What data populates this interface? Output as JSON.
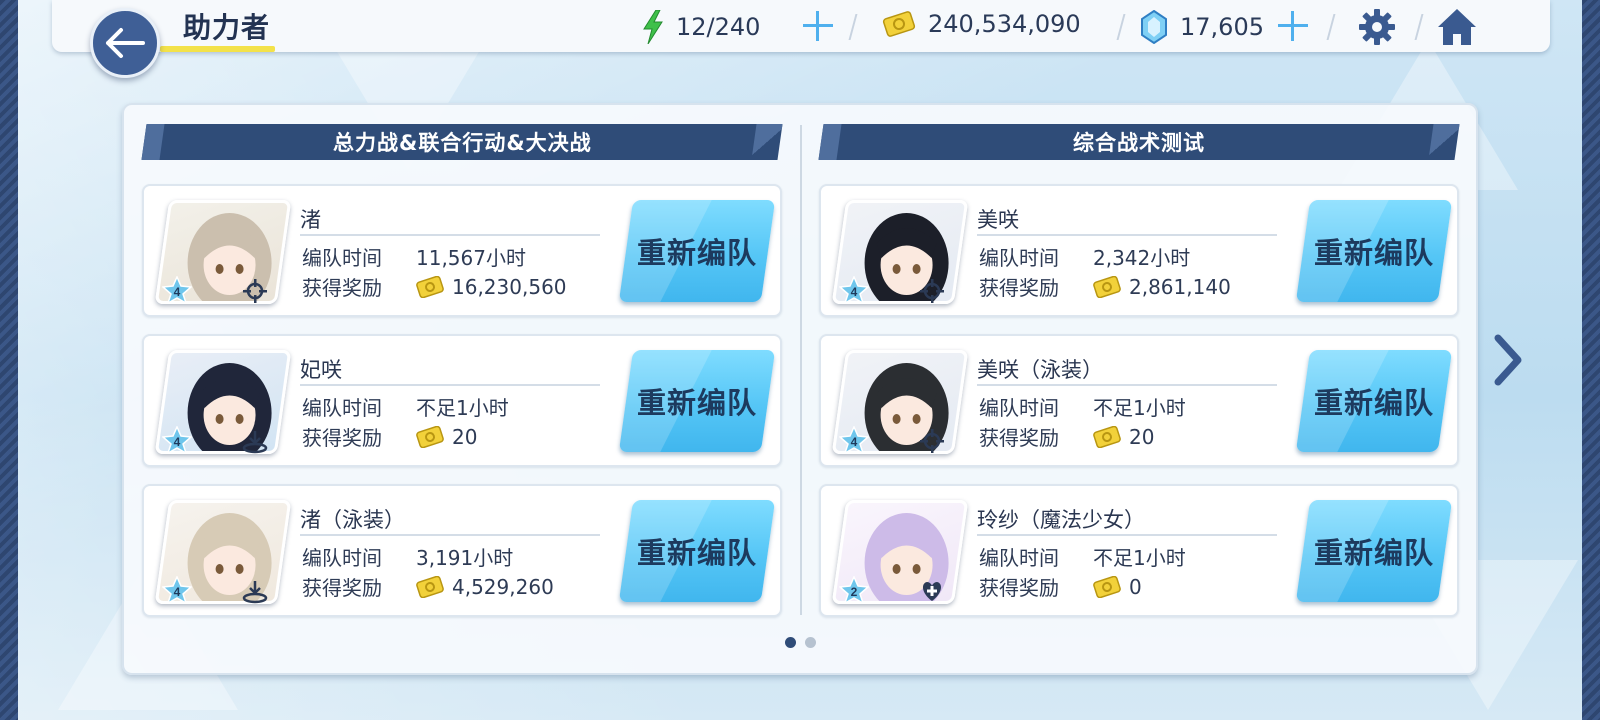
{
  "header": {
    "title": "助力者",
    "energy": "12/240",
    "credits": "240,534,090",
    "gems": "17,605"
  },
  "sections": [
    {
      "title": "总力战&联合行动&大决战"
    },
    {
      "title": "综合战术测试"
    }
  ],
  "labels": {
    "time_label": "编队时间",
    "reward_label": "获得奖励",
    "reform_button": "重新编队"
  },
  "left_cards": [
    {
      "name": "渚",
      "time": "11,567小时",
      "reward": "16,230,560",
      "star": "4",
      "role": "target"
    },
    {
      "name": "妃咲",
      "time": "不足1小时",
      "reward": "20",
      "star": "4",
      "role": "support"
    },
    {
      "name": "渚（泳装）",
      "time": "3,191小时",
      "reward": "4,529,260",
      "star": "4",
      "role": "support"
    }
  ],
  "right_cards": [
    {
      "name": "美咲",
      "time": "2,342小时",
      "reward": "2,861,140",
      "star": "4",
      "role": "target"
    },
    {
      "name": "美咲（泳装）",
      "time": "不足1小时",
      "reward": "20",
      "star": "4",
      "role": "target"
    },
    {
      "name": "玲纱（魔法少女）",
      "time": "不足1小时",
      "reward": "0",
      "star": "2",
      "role": "heal"
    }
  ],
  "pagination": {
    "current": 1,
    "total": 2
  },
  "colors": {
    "accent_blue": "#55c6f6",
    "navy": "#2f4c78",
    "title_underline": "#f3e24a",
    "energy_green": "#3fc04a",
    "credit_yellow": "#f2d13a"
  },
  "icons": [
    "back-arrow-icon",
    "energy-icon",
    "credit-icon",
    "gem-icon",
    "plus-icon",
    "gear-icon",
    "home-icon",
    "star-icon",
    "target-icon",
    "support-icon",
    "heal-icon",
    "chevron-right-icon"
  ]
}
